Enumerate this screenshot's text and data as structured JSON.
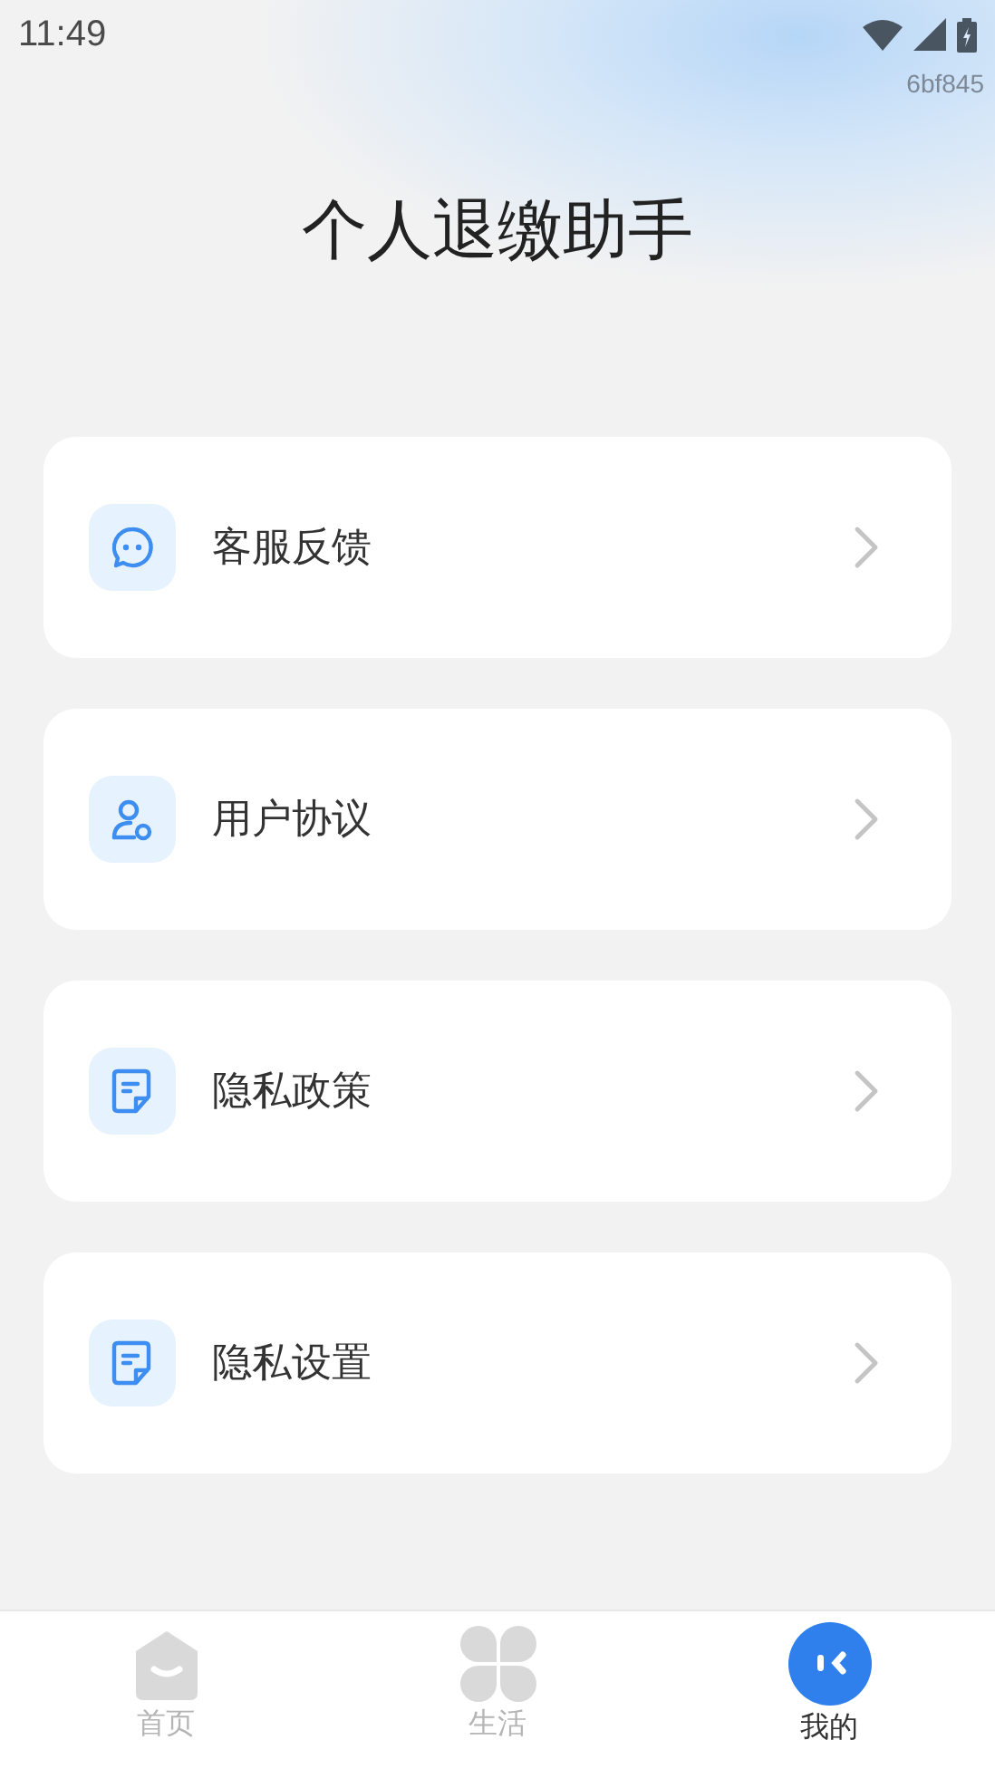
{
  "status_bar": {
    "time": "11:49",
    "build": "6bf845"
  },
  "title": "个人退缴助手",
  "menu": [
    {
      "label": "客服反馈",
      "kind": "chat"
    },
    {
      "label": "用户协议",
      "kind": "user"
    },
    {
      "label": "隐私政策",
      "kind": "doc"
    },
    {
      "label": "隐私设置",
      "kind": "doc"
    }
  ],
  "tabs": [
    {
      "label": "首页",
      "kind": "home",
      "selected": false
    },
    {
      "label": "生活",
      "kind": "life",
      "selected": false
    },
    {
      "label": "我的",
      "kind": "me",
      "selected": true
    }
  ]
}
